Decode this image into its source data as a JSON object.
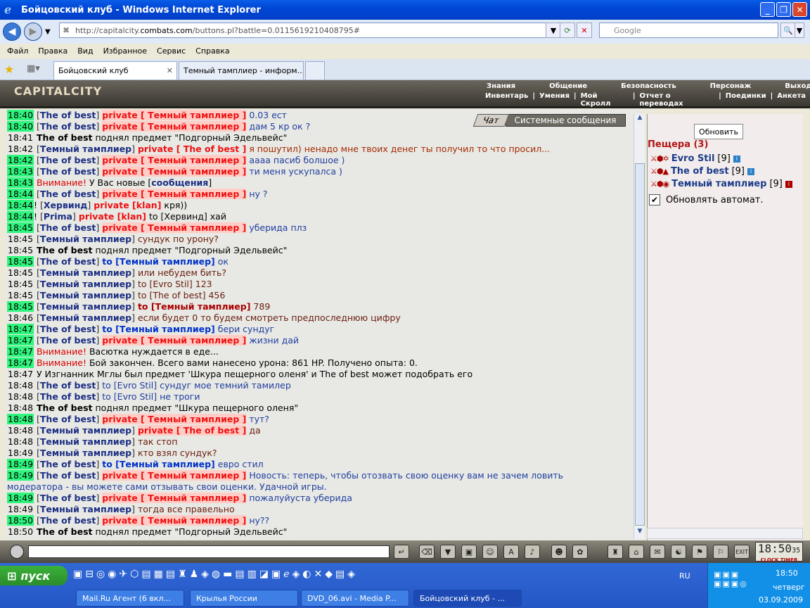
{
  "window": {
    "title": "Бойцовский клуб - Windows Internet Explorer"
  },
  "nav": {
    "url_prefix": "http://capitalcity.",
    "url_host": "combats.com",
    "url_path": "/buttons.pl?battle=0.0115619210408795#",
    "search_placeholder": "Google"
  },
  "menu": [
    "Файл",
    "Правка",
    "Вид",
    "Избранное",
    "Сервис",
    "Справка"
  ],
  "tabs": [
    {
      "label": "Бойцовский клуб",
      "active": true
    },
    {
      "label": "Темный тамплиер - информ..."
    }
  ],
  "game": {
    "logo": "CAPITALCITY",
    "menu_top": [
      "Знания",
      "Общение",
      "Безопасность",
      "Персонаж",
      "Выход"
    ],
    "menu_bottom": [
      "Инвентарь",
      "Умения",
      "Мой Скролл",
      "Отчет о переводах",
      "Поединки",
      "Анкета"
    ],
    "chat_tabs": [
      "Чат",
      "Системные сообщения"
    ]
  },
  "chat": [
    {
      "t": "18:40",
      "h": true,
      "parts": [
        [
          "nm",
          "The of best"
        ],
        [
          "pv",
          "private [ Темный тамплиер ]"
        ],
        [
          "msg",
          "0.03 ест"
        ]
      ]
    },
    {
      "t": "18:40",
      "h": true,
      "parts": [
        [
          "nm",
          "The of best"
        ],
        [
          "pv",
          "private [ Темный тамплиер ]"
        ],
        [
          "msg",
          "дам 5 кр ок ?"
        ]
      ]
    },
    {
      "t": "18:41",
      "h": false,
      "parts": [
        [
          "sys",
          "The of best"
        ],
        [
          "plain",
          "поднял предмет \"Подгорный Эдельвейс\""
        ]
      ]
    },
    {
      "t": "18:42",
      "h": false,
      "parts": [
        [
          "nm",
          "Темный тамплиер"
        ],
        [
          "pv2",
          "private [ The of best ]"
        ],
        [
          "msgb",
          "я пошутил) ненадо мне твоих денег ты получил то что просил..."
        ]
      ]
    },
    {
      "t": "18:42",
      "h": true,
      "parts": [
        [
          "nm",
          "The of best"
        ],
        [
          "pv",
          "private [ Темный тамплиер ]"
        ],
        [
          "msg",
          "аааа пасиб болшое )"
        ]
      ]
    },
    {
      "t": "18:43",
      "h": true,
      "parts": [
        [
          "nm",
          "The of best"
        ],
        [
          "pv",
          "private [ Темный тамплиер ]"
        ],
        [
          "msg",
          "ти меня ускупалса )"
        ]
      ]
    },
    {
      "t": "18:43",
      "h": true,
      "parts": [
        [
          "warn",
          "Внимание!"
        ],
        [
          "plain",
          "У Вас новые"
        ],
        [
          "link",
          "сообщения"
        ]
      ]
    },
    {
      "t": "18:44",
      "h": true,
      "parts": [
        [
          "nm",
          "The of best"
        ],
        [
          "pv",
          "private [ Темный тамплиер ]"
        ],
        [
          "msg",
          "ну ?"
        ]
      ]
    },
    {
      "t": "18:44",
      "h": true,
      "bang": true,
      "parts": [
        [
          "nm",
          "Хервинд"
        ],
        [
          "pv2",
          "private [klan]"
        ],
        [
          "plain",
          "кря))"
        ]
      ]
    },
    {
      "t": "18:44",
      "h": true,
      "bang": true,
      "parts": [
        [
          "nm",
          "Prima"
        ],
        [
          "pv2",
          "private [klan]"
        ],
        [
          "plain",
          "to [Хервинд] хай"
        ]
      ]
    },
    {
      "t": "18:45",
      "h": true,
      "parts": [
        [
          "nm",
          "The of best"
        ],
        [
          "pv",
          "private [ Темный тамплиер ]"
        ],
        [
          "msg",
          "уберида плз"
        ]
      ]
    },
    {
      "t": "18:45",
      "h": false,
      "parts": [
        [
          "nm",
          "Темный тамплиер"
        ],
        [
          "msgr",
          "сундук по урону?"
        ]
      ]
    },
    {
      "t": "18:45",
      "h": false,
      "parts": [
        [
          "sys",
          "The of best"
        ],
        [
          "plain",
          "поднял предмет \"Подгорный Эдельвейс\""
        ]
      ]
    },
    {
      "t": "18:45",
      "h": true,
      "parts": [
        [
          "nm",
          "The of best"
        ],
        [
          "to",
          "to [Темный тамплиер]"
        ],
        [
          "msg",
          "ок"
        ]
      ]
    },
    {
      "t": "18:45",
      "h": false,
      "parts": [
        [
          "nm",
          "Темный тамплиер"
        ],
        [
          "msgr",
          "или небудем бить?"
        ]
      ]
    },
    {
      "t": "18:45",
      "h": false,
      "parts": [
        [
          "nm",
          "Темный тамплиер"
        ],
        [
          "msgr",
          "to [Evro Stil] 123"
        ]
      ]
    },
    {
      "t": "18:45",
      "h": false,
      "parts": [
        [
          "nm",
          "Темный тамплиер"
        ],
        [
          "msgr",
          "to [The of best] 456"
        ]
      ]
    },
    {
      "t": "18:45",
      "h": true,
      "parts": [
        [
          "nm",
          "Темный тамплиер"
        ],
        [
          "toRed",
          "to [Темный тамплиер]"
        ],
        [
          "msgr",
          "789"
        ]
      ]
    },
    {
      "t": "18:46",
      "h": false,
      "parts": [
        [
          "nm",
          "Темный тамплиер"
        ],
        [
          "msgr",
          "если будет 0 то будем смотреть предпоследнюю цифру"
        ]
      ]
    },
    {
      "t": "18:47",
      "h": true,
      "parts": [
        [
          "nm",
          "The of best"
        ],
        [
          "to",
          "to [Темный тамплиер]"
        ],
        [
          "msg",
          "бери сундуг"
        ]
      ]
    },
    {
      "t": "18:47",
      "h": true,
      "parts": [
        [
          "nm",
          "The of best"
        ],
        [
          "pv",
          "private [ Темный тамплиер ]"
        ],
        [
          "msg",
          "жизни дай"
        ]
      ]
    },
    {
      "t": "18:47",
      "h": true,
      "parts": [
        [
          "warn",
          "Внимание!"
        ],
        [
          "plain",
          "Васютка нуждается в еде..."
        ]
      ]
    },
    {
      "t": "18:47",
      "h": true,
      "parts": [
        [
          "warn",
          "Внимание!"
        ],
        [
          "plain",
          "Бой закончен. Всего вами нанесено урона: 861 HP. Получено опыта: 0."
        ]
      ]
    },
    {
      "t": "18:47",
      "h": false,
      "parts": [
        [
          "plain",
          "У Изгнанник Мглы был предмет 'Шкура пещерного оленя' и The of best может подобрать его"
        ]
      ]
    },
    {
      "t": "18:48",
      "h": false,
      "parts": [
        [
          "nm",
          "The of best"
        ],
        [
          "msg",
          "to [Evro Stil] сундуг мое темний тамилер"
        ]
      ]
    },
    {
      "t": "18:48",
      "h": false,
      "parts": [
        [
          "nm",
          "The of best"
        ],
        [
          "msg",
          "to [Evro Stil] не троги"
        ]
      ]
    },
    {
      "t": "18:48",
      "h": false,
      "parts": [
        [
          "sys",
          "The of best"
        ],
        [
          "plain",
          "поднял предмет \"Шкура пещерного оленя\""
        ]
      ]
    },
    {
      "t": "18:48",
      "h": true,
      "parts": [
        [
          "nm",
          "The of best"
        ],
        [
          "pv",
          "private [ Темный тамплиер ]"
        ],
        [
          "msg",
          "тут?"
        ]
      ]
    },
    {
      "t": "18:48",
      "h": false,
      "parts": [
        [
          "nm",
          "Темный тамплиер"
        ],
        [
          "pv",
          "private [ The of best ]"
        ],
        [
          "msgr",
          "да"
        ]
      ]
    },
    {
      "t": "18:48",
      "h": false,
      "parts": [
        [
          "nm",
          "Темный тамплиер"
        ],
        [
          "msgr",
          "так стоп"
        ]
      ]
    },
    {
      "t": "18:49",
      "h": false,
      "parts": [
        [
          "nm",
          "Темный тамплиер"
        ],
        [
          "msgr",
          "кто взял сундук?"
        ]
      ]
    },
    {
      "t": "18:49",
      "h": true,
      "parts": [
        [
          "nm",
          "The of best"
        ],
        [
          "to",
          "to [Темный тамплиер]"
        ],
        [
          "msg",
          "евро стил"
        ]
      ]
    },
    {
      "t": "18:49",
      "h": true,
      "parts": [
        [
          "nm",
          "The of best"
        ],
        [
          "pv",
          "private [ Темный тамплиер ]"
        ],
        [
          "msg",
          "Новость: теперь, чтобы отозвать свою оценку вам не зачем ловить"
        ]
      ]
    },
    {
      "cont": true,
      "parts": [
        [
          "msg",
          "модератора - вы можете сами отзывать свои оценки. Удачной игры."
        ]
      ]
    },
    {
      "t": "18:49",
      "h": true,
      "parts": [
        [
          "nm",
          "The of best"
        ],
        [
          "pv",
          "private [ Темный тамплиер ]"
        ],
        [
          "msg",
          "пожалуйуста уберида"
        ]
      ]
    },
    {
      "t": "18:49",
      "h": false,
      "parts": [
        [
          "nm",
          "Темный тамплиер"
        ],
        [
          "msgr",
          "тогда все правельно"
        ]
      ]
    },
    {
      "t": "18:50",
      "h": true,
      "parts": [
        [
          "nm",
          "The of best"
        ],
        [
          "pv",
          "private [ Темный тамплиер ]"
        ],
        [
          "msg",
          "ну??"
        ]
      ]
    },
    {
      "t": "18:50",
      "h": false,
      "parts": [
        [
          "sys",
          "The of best"
        ],
        [
          "plain",
          "поднял предмет \"Подгорный Эдельвейс\""
        ]
      ]
    }
  ],
  "room": {
    "refresh_label": "Обновить",
    "location": "Пещера (3)",
    "players": [
      {
        "name": "Evro Stil",
        "level": "[9]"
      },
      {
        "name": "The of best",
        "level": "[9]"
      },
      {
        "name": "Темный тамплиер",
        "level": "[9]"
      }
    ],
    "auto_update_label": "Обновлять автомат.",
    "auto_update_checked": true
  },
  "clock": {
    "time": "18:50",
    "seconds": "35",
    "label1": "CLOCK",
    "label2": "TIMER"
  },
  "taskbar": {
    "start_label": "пуск",
    "tasks": [
      "Mail.Ru Агент (6 вкл...",
      "Крылья России",
      "DVD_06.avi - Media P...",
      "Бойцовский клуб - ..."
    ],
    "lang": "RU",
    "time": "18:50",
    "day": "четверг",
    "date": "03.09.2009"
  }
}
